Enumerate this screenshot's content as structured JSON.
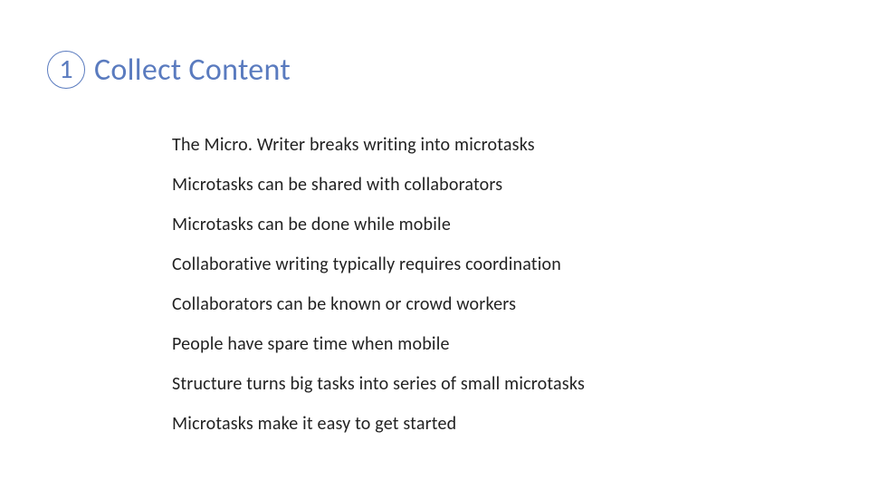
{
  "header": {
    "step_number": "1",
    "title": "Collect Content"
  },
  "body": {
    "items": [
      "The Micro. Writer breaks writing into microtasks",
      "Microtasks can be shared with collaborators",
      "Microtasks can be done while mobile",
      "Collaborative writing typically requires coordination",
      "Collaborators can be known or crowd workers",
      "People have spare time when mobile",
      "Structure turns big tasks into series of small microtasks",
      "Microtasks make it easy to get started"
    ]
  }
}
